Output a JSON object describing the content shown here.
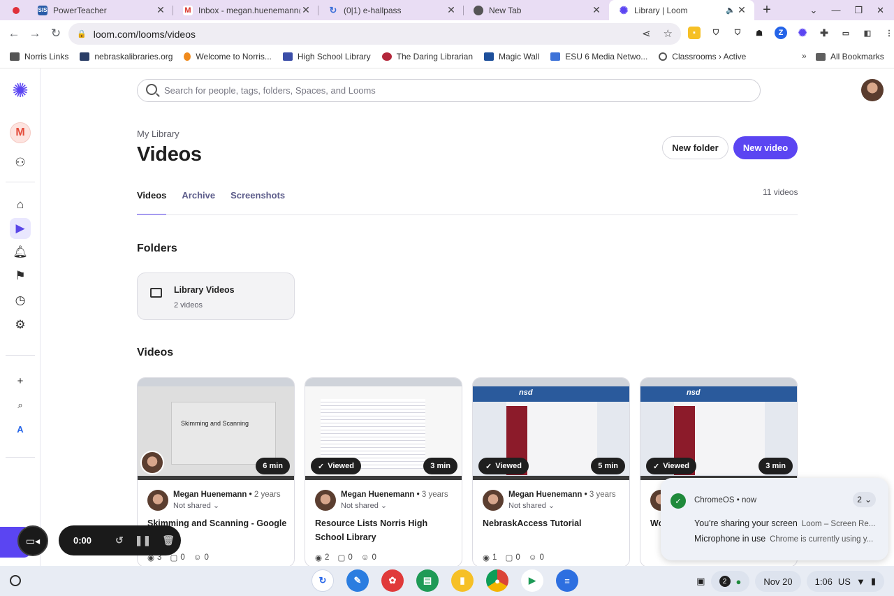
{
  "browser": {
    "tabs": [
      {
        "title": "",
        "icon": "record-icon"
      },
      {
        "title": "PowerTeacher",
        "icon": "sis-icon"
      },
      {
        "title": "Inbox - megan.huenemann@n",
        "icon": "gmail-icon"
      },
      {
        "title": "(0|1) e-hallpass",
        "icon": "ehallpass-icon"
      },
      {
        "title": "New Tab",
        "icon": "chrome-icon"
      },
      {
        "title": "Library | Loom",
        "icon": "loom-icon",
        "active": true
      }
    ],
    "url": "loom.com/looms/videos",
    "bookmarks": [
      "Norris Links",
      "nebraskalibraries.org",
      "Welcome to Norris...",
      "High School Library",
      "The Daring Librarian",
      "Magic Wall",
      "ESU 6 Media Netwo...",
      "Classrooms › Active"
    ],
    "bookmarks_more": "»",
    "all_bookmarks": "All Bookmarks"
  },
  "app": {
    "workspace_initial": "M",
    "search_placeholder": "Search for people, tags, folders, Spaces, and Looms",
    "breadcrumb": "My Library",
    "page_title": "Videos",
    "new_folder_label": "New folder",
    "new_video_label": "New video",
    "tabs": [
      "Videos",
      "Archive",
      "Screenshots"
    ],
    "video_count": "11 videos",
    "folders_heading": "Folders",
    "folder": {
      "name": "Library Videos",
      "count": "2 videos"
    },
    "videos_heading": "Videos",
    "videos": [
      {
        "duration": "6 min",
        "viewed": "",
        "author": "Megan Huenemann",
        "age": "2 years",
        "shared": "Not shared",
        "title": "Skimming and Scanning - Google",
        "views": "3",
        "comments": "0",
        "reactions": "0",
        "thumb_text": "Skimming and Scanning"
      },
      {
        "duration": "3 min",
        "viewed": "Viewed",
        "author": "Megan Huenemann",
        "age": "3 years",
        "shared": "Not shared",
        "title": "Resource Lists Norris High School Library",
        "views": "2",
        "comments": "0",
        "reactions": "0"
      },
      {
        "duration": "5 min",
        "viewed": "Viewed",
        "author": "Megan Huenemann",
        "age": "3 years",
        "shared": "Not shared",
        "title": "NebraskAccess Tutorial",
        "views": "1",
        "comments": "0",
        "reactions": "0",
        "thumb_text": "nsd"
      },
      {
        "duration": "3 min",
        "viewed": "Viewed",
        "author": "Megan Huenemann",
        "age": "",
        "shared": "",
        "title": "Wo",
        "views": "",
        "comments": "",
        "reactions": "",
        "thumb_text": "nsd"
      }
    ]
  },
  "recorder": {
    "time": "0:00"
  },
  "notification": {
    "source": "ChromeOS",
    "when": "now",
    "count": "2",
    "line1": "You're sharing your screen",
    "line1_sub": "Loom – Screen Re...",
    "line2": "Microphone in use",
    "line2_sub": "Chrome is currently using y..."
  },
  "shelf": {
    "badge": "2",
    "date": "Nov 20",
    "time": "1:06",
    "locale": "US"
  }
}
